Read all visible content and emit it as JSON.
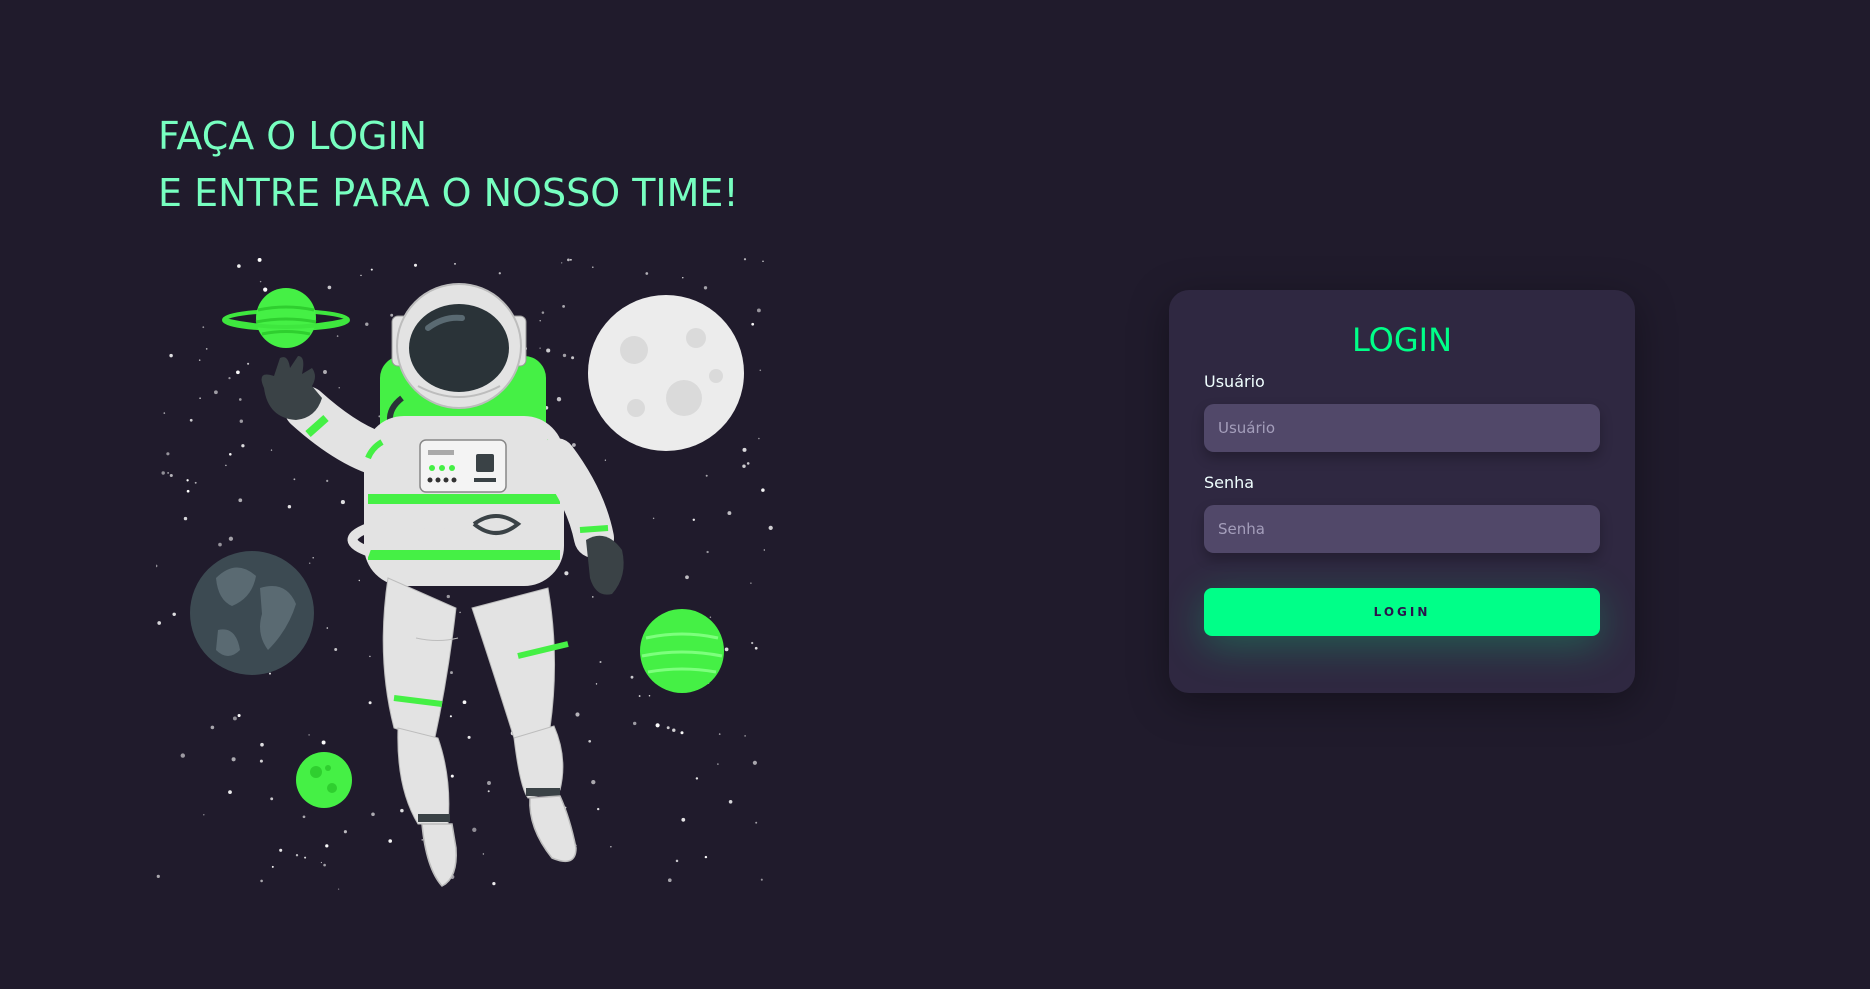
{
  "hero": {
    "line1": "FAÇA O LOGIN",
    "line2": "E ENTRE PARA O NOSSO TIME!"
  },
  "illustration": {
    "subject": "astronaut-floating-in-space"
  },
  "login_card": {
    "title": "LOGIN",
    "username": {
      "label": "Usuário",
      "placeholder": "Usuário",
      "value": ""
    },
    "password": {
      "label": "Senha",
      "placeholder": "Senha",
      "value": ""
    },
    "button_label": "LOGIN"
  },
  "colors": {
    "background": "#201b2c",
    "card": "#2f2841",
    "input": "#514869",
    "accent": "#00ff88",
    "headline": "#77ffc0"
  }
}
